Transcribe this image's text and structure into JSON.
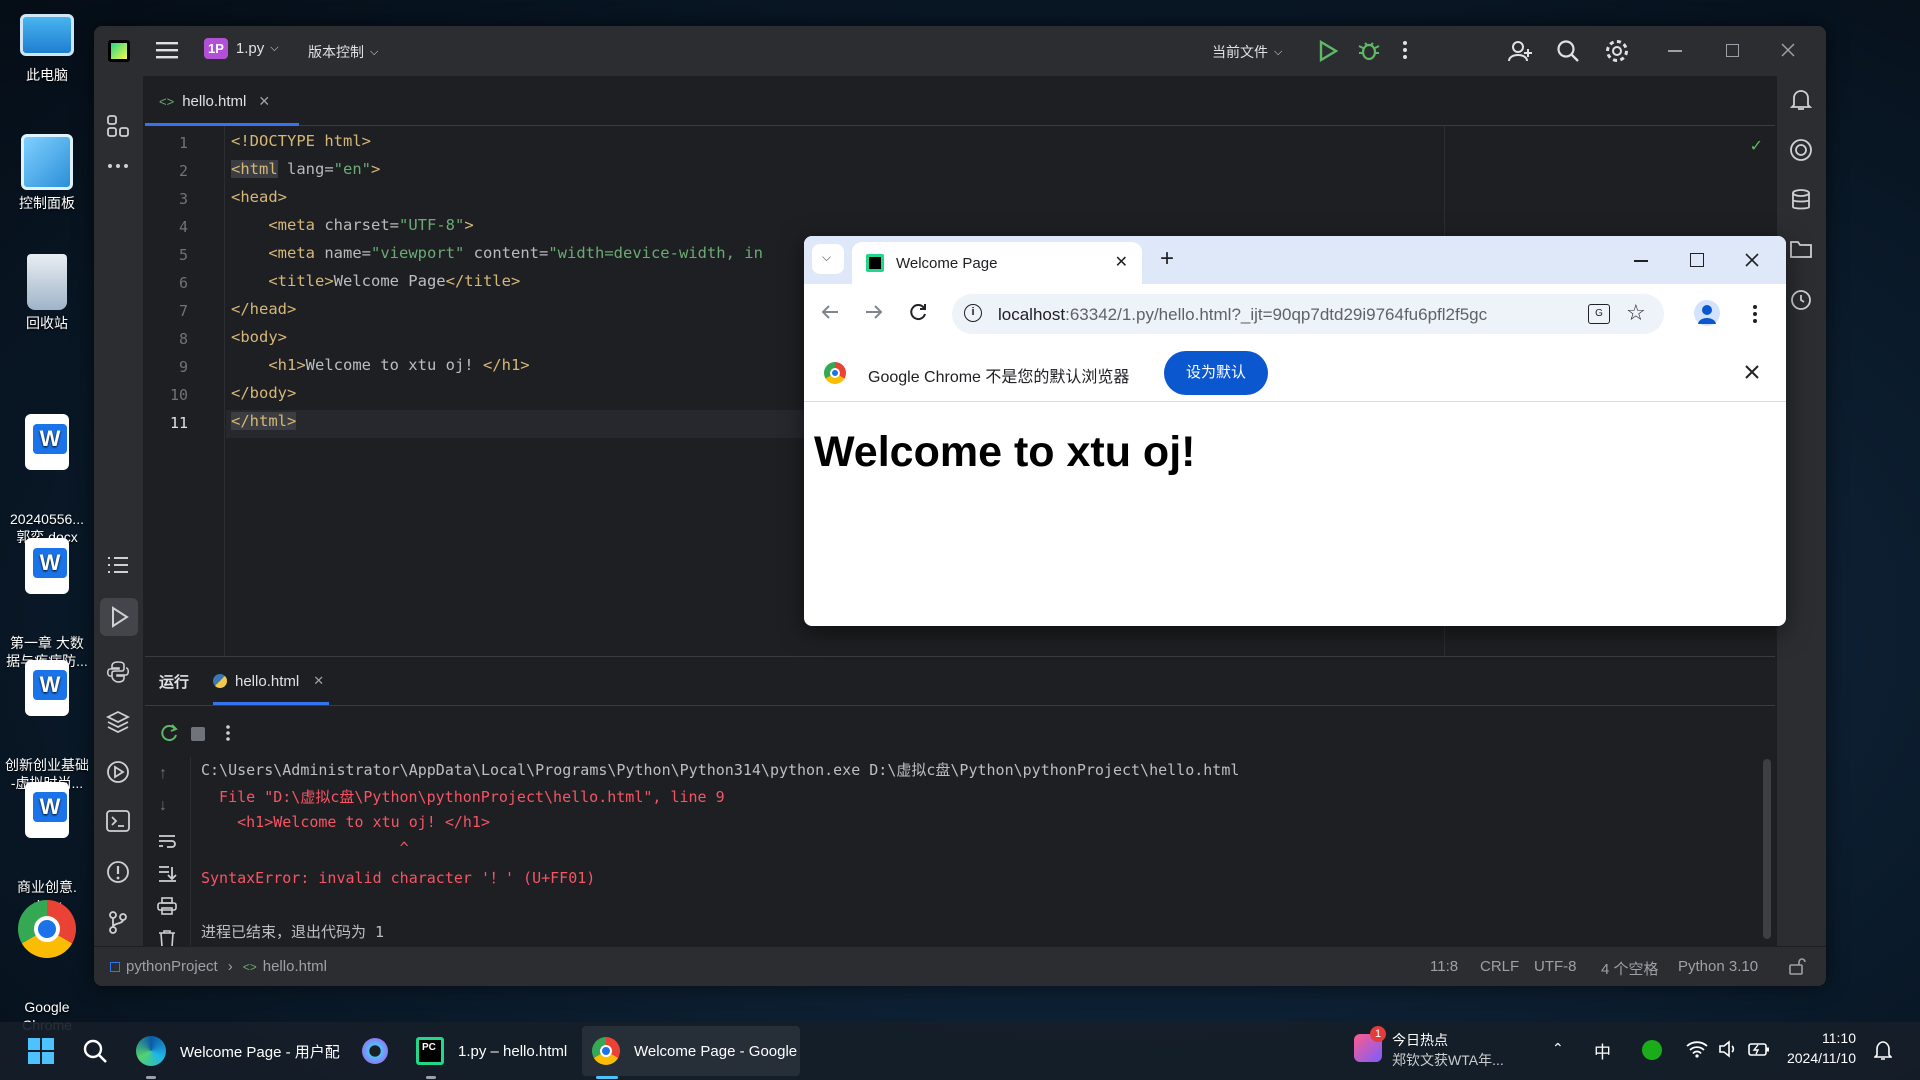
{
  "desktop": {
    "icons": [
      {
        "label": "此电脑"
      },
      {
        "label": "控制面板"
      },
      {
        "label": "回收站"
      },
      {
        "label": "20240556...\n郭奕.docx"
      },
      {
        "label": "第一章 大数\n据与疾病防..."
      },
      {
        "label": "创新创业基础\n-虚拟时尚..."
      },
      {
        "label": "商业创意.\ndocx"
      },
      {
        "label": "Google\nChrome"
      }
    ]
  },
  "ide": {
    "project_badge": "1P",
    "project_name": "1.py",
    "vcs_menu": "版本控制",
    "run_config": "当前文件",
    "editor_tab": "hello.html",
    "line_numbers": [
      "1",
      "2",
      "3",
      "4",
      "5",
      "6",
      "7",
      "8",
      "9",
      "10",
      "11"
    ],
    "code": {
      "l1": "<!DOCTYPE html>",
      "l2_tag": "<html",
      "l2_attr": " lang=",
      "l2_val": "\"en\"",
      "l2_end": ">",
      "l3": "<head>",
      "l4_tag": "    <meta",
      "l4_attr": " charset=",
      "l4_val": "\"UTF-8\"",
      "l4_end": ">",
      "l5_tag": "    <meta",
      "l5_attr1": " name=",
      "l5_val1": "\"viewport\"",
      "l5_attr2": " content=",
      "l5_val2": "\"width=device-width, in",
      "l6_open": "    <title>",
      "l6_text": "Welcome Page",
      "l6_close": "</title>",
      "l7": "</head>",
      "l8": "<body>",
      "l9_open": "    <h1>",
      "l9_text": "Welcome to xtu oj! ",
      "l9_close": "</h1>",
      "l10": "</body>",
      "l11": "</html>"
    },
    "run_panel": {
      "title": "运行",
      "tab": "hello.html",
      "output": [
        "C:\\Users\\Administrator\\AppData\\Local\\Programs\\Python\\Python314\\python.exe D:\\虚拟c盘\\Python\\pythonProject\\hello.html",
        "  File \"D:\\虚拟c盘\\Python\\pythonProject\\hello.html\", line 9",
        "    <h1>Welcome to xtu oj! </h1>",
        "                      ^",
        "SyntaxError: invalid character '！' (U+FF01)",
        "进程已结束，退出代码为 1"
      ]
    },
    "status": {
      "breadcrumb_project": "pythonProject",
      "breadcrumb_file": "hello.html",
      "position": "11:8",
      "line_sep": "CRLF",
      "encoding": "UTF-8",
      "indent": "4 个空格",
      "interpreter": "Python 3.10"
    }
  },
  "chrome": {
    "tab_title": "Welcome Page",
    "url_host": "localhost",
    "url_rest": ":63342/1.py/hello.html?_ijt=90qp7dtd29i9764fu6pfl2f5gc",
    "infobar_text": "Google Chrome 不是您的默认浏览器",
    "infobar_button": "设为默认",
    "heading": "Welcome to xtu oj!"
  },
  "taskbar": {
    "apps": [
      {
        "label": "Welcome Page - 用户配"
      },
      {
        "label": "1.py – hello.html"
      },
      {
        "label": "Welcome Page - Google"
      }
    ],
    "news_badge": "1",
    "news_title": "今日热点",
    "news_sub": "郑钦文获WTA年...",
    "ime": "中",
    "time": "11:10",
    "date": "2024/11/10"
  },
  "colors": {
    "ide_bg": "#1e1f22",
    "ide_panel": "#2b2d30",
    "error_red": "#f75464",
    "chrome_accent": "#0b57d0"
  }
}
